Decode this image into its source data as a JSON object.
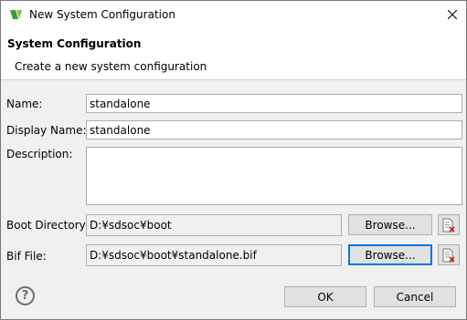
{
  "window": {
    "title": "New System Configuration"
  },
  "banner": {
    "title": "System Configuration",
    "description": "Create a new system configuration"
  },
  "form": {
    "name_label": "Name:",
    "name_value": "standalone",
    "display_name_label": "Display Name:",
    "display_name_value": "standalone",
    "description_label": "Description:",
    "description_value": "",
    "boot_dir_label": "Boot Directory:",
    "boot_dir_value": "D:¥sdsoc¥boot",
    "bif_label": "Bif File:",
    "bif_value": "D:¥sdsoc¥boot¥standalone.bif",
    "browse_label": "Browse..."
  },
  "footer": {
    "help_glyph": "?",
    "ok_label": "OK",
    "cancel_label": "Cancel"
  },
  "icons": {
    "app": "eclipse-xilinx-icon",
    "close": "close-icon",
    "clear": "clear-field-icon",
    "help": "help-icon"
  }
}
